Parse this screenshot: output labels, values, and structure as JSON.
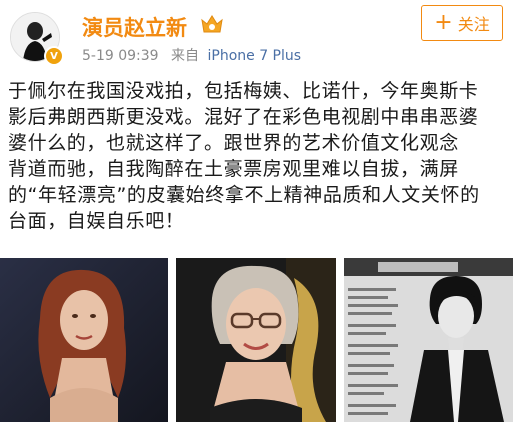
{
  "post": {
    "username": "演员赵立新",
    "timestamp": "5-19 09:39",
    "source_prefix": "来自",
    "device": "iPhone 7 Plus",
    "follow_label": "关注",
    "follow_icon": "plus-icon",
    "lines": [
      "于佩尔在我国没戏拍，包括梅姨、比诺什，今年奥斯卡",
      "影后弗朗西斯更没戏。混好了在彩色电视剧中串串恶婆",
      "婆什么的，也就这样了。跟世界的艺术价值文化观念",
      "背道而驰，自我陶醉在土豪票房观里难以自拔，满屏",
      "的“年轻漂亮”的皮囊始终拿不上精神品质和人文关怀的",
      "台面，自娱自乐吧！"
    ]
  },
  "photos": [
    {
      "name": "photo-1",
      "icon": "woman-portrait-red-hair"
    },
    {
      "name": "photo-2",
      "icon": "woman-portrait-glasses"
    },
    {
      "name": "photo-3",
      "icon": "magazine-page-bw-portrait"
    }
  ],
  "colors": {
    "accent": "#f28a12",
    "meta_text": "#8a8a8a",
    "device_link": "#4a6fa5",
    "body_text": "#1a1a1a"
  }
}
